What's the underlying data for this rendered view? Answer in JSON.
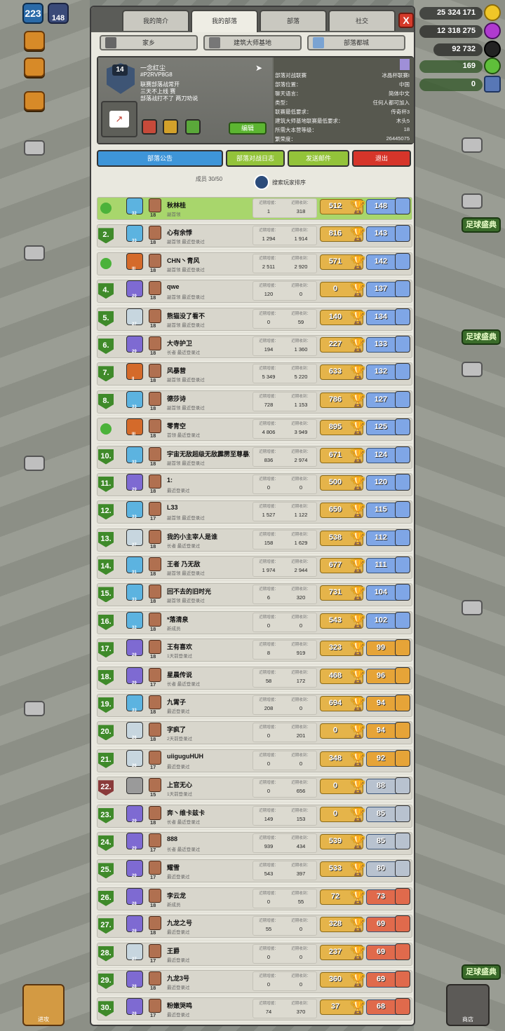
{
  "hud": {
    "level": "223",
    "troops_count": "148",
    "resources": [
      "25 324 171",
      "12 318 275",
      "92 732",
      "169",
      "0"
    ],
    "banner_labels": [
      "足球盛典",
      "足球盛典",
      "足球盛典"
    ]
  },
  "tabs": [
    {
      "label": "我的简介"
    },
    {
      "label": "我的部落"
    },
    {
      "label": "部落"
    },
    {
      "label": "社交"
    }
  ],
  "close_label": "X",
  "subtabs": [
    {
      "label": "家乡"
    },
    {
      "label": "建筑大师基地"
    },
    {
      "label": "部落都城"
    }
  ],
  "clan": {
    "level": "14",
    "name": "一念红尘",
    "tag": "#P2RVP8G8",
    "description_lines": [
      "联赛部落战常开",
      "三天不上线 赛",
      "部落战打不了 两刀劝说"
    ],
    "info_rows": [
      {
        "k": "部落对战联赛",
        "v": "冰晶杯联赛I"
      },
      {
        "k": "部落位置：",
        "v": "中国"
      },
      {
        "k": "聊天语言：",
        "v": "简体中文"
      },
      {
        "k": "类型：",
        "v": "任何人都可加入"
      },
      {
        "k": "联赛最低要求：",
        "v": "传奇杯3"
      },
      {
        "k": "建筑大师基地联赛最低要求：",
        "v": "木头5"
      },
      {
        "k": "所需大本营等级：",
        "v": "18"
      },
      {
        "k": "繁荣度：",
        "v": "26445075"
      }
    ],
    "edit_label": "编辑"
  },
  "actions": [
    {
      "label": "部落公告"
    },
    {
      "label": "部落对战日志"
    },
    {
      "label": "发送邮件"
    },
    {
      "label": "退出"
    }
  ],
  "members_label": "成员 30/50",
  "members_search_label": "搜索玩家排序",
  "stat_labels": {
    "donated": "近期增援：",
    "received": "近期收到："
  },
  "rows": [
    {
      "rank": "",
      "league": "32",
      "th": "18",
      "name": "秋林桂",
      "role": "副首领",
      "d": "1",
      "r": "318",
      "trophy": "512",
      "pvp": "148",
      "hl": "leader"
    },
    {
      "rank": "2.",
      "league": "33",
      "th": "18",
      "name": "心有余悸",
      "role": "副首领 最近登录过",
      "d": "1 294",
      "r": "1 914",
      "trophy": "816",
      "pvp": "143"
    },
    {
      "rank": "",
      "league": "III",
      "th": "18",
      "name": "CHN丶青风",
      "role": "副首领 最近登录过",
      "d": "2 511",
      "r": "2 920",
      "trophy": "571",
      "pvp": "142"
    },
    {
      "rank": "4.",
      "league": "29",
      "th": "18",
      "name": "qwe",
      "role": "副首领 最近登录过",
      "d": "120",
      "r": "0",
      "trophy": "0",
      "pvp": "137"
    },
    {
      "rank": "5.",
      "league": "27",
      "th": "18",
      "name": "熊猫没了看不",
      "role": "副首领 最近登录过",
      "d": "0",
      "r": "59",
      "trophy": "140",
      "pvp": "134"
    },
    {
      "rank": "6.",
      "league": "29",
      "th": "18",
      "name": "大寺护卫",
      "role": "长者 最近登录过",
      "d": "194",
      "r": "1 360",
      "trophy": "227",
      "pvp": "133"
    },
    {
      "rank": "7.",
      "league": "II",
      "th": "18",
      "name": "风暴营",
      "role": "副首领 最近登录过",
      "d": "5 349",
      "r": "5 220",
      "trophy": "633",
      "pvp": "132"
    },
    {
      "rank": "8.",
      "league": "33",
      "th": "18",
      "name": "德莎诗",
      "role": "副首领 最近登录过",
      "d": "728",
      "r": "1 153",
      "trophy": "786",
      "pvp": "127"
    },
    {
      "rank": "",
      "league": "III",
      "th": "18",
      "name": "零青空",
      "role": "首领 最近登录过",
      "d": "4 806",
      "r": "3 949",
      "trophy": "895",
      "pvp": "125"
    },
    {
      "rank": "10.",
      "league": "32",
      "th": "18",
      "name": "宇宙无敌超级无敌霹雳至尊暴龙战士",
      "role": "副首领 最近登录过",
      "d": "836",
      "r": "2 974",
      "trophy": "671",
      "pvp": "124"
    },
    {
      "rank": "11.",
      "league": "29",
      "th": "18",
      "name": "1:",
      "role": "最近登录过",
      "d": "0",
      "r": "0",
      "trophy": "500",
      "pvp": "120"
    },
    {
      "rank": "12.",
      "league": "33",
      "th": "17",
      "name": "L33",
      "role": "副首领 最近登录过",
      "d": "1 527",
      "r": "1 122",
      "trophy": "659",
      "pvp": "115"
    },
    {
      "rank": "13.",
      "league": "27",
      "th": "18",
      "name": "我的小主宰人是谁",
      "role": "长者 最近登录过",
      "d": "158",
      "r": "1 629",
      "trophy": "538",
      "pvp": "112"
    },
    {
      "rank": "14.",
      "league": "31",
      "th": "18",
      "name": "王者 乃无敌",
      "role": "副首领 最近登录过",
      "d": "1 974",
      "r": "2 944",
      "trophy": "677",
      "pvp": "111"
    },
    {
      "rank": "15.",
      "league": "33",
      "th": "18",
      "name": "回不去的旧时光",
      "role": "副首领 最近登录过",
      "d": "6",
      "r": "320",
      "trophy": "731",
      "pvp": "104"
    },
    {
      "rank": "16.",
      "league": "32",
      "th": "18",
      "name": "*落清泉",
      "role": "新成员",
      "d": "0",
      "r": "0",
      "trophy": "543",
      "pvp": "102"
    },
    {
      "rank": "17.",
      "league": "28",
      "th": "18",
      "name": "王有喜欢",
      "role": "1天前登录过",
      "d": "8",
      "r": "919",
      "trophy": "323",
      "pvp": "99"
    },
    {
      "rank": "18.",
      "league": "29",
      "th": "17",
      "name": "星晨传说",
      "role": "长者 最近登录过",
      "d": "58",
      "r": "172",
      "trophy": "468",
      "pvp": "96"
    },
    {
      "rank": "19.",
      "league": "33",
      "th": "18",
      "name": "九霄子",
      "role": "最近登录过",
      "d": "208",
      "r": "0",
      "trophy": "694",
      "pvp": "94"
    },
    {
      "rank": "20.",
      "league": "26",
      "th": "18",
      "name": "字疯了",
      "role": "2天前登录过",
      "d": "0",
      "r": "201",
      "trophy": "0",
      "pvp": "94"
    },
    {
      "rank": "21.",
      "league": "26",
      "th": "17",
      "name": "uiiguguHUH",
      "role": "最近登录过",
      "d": "0",
      "r": "0",
      "trophy": "348",
      "pvp": "92"
    },
    {
      "rank": "22.",
      "league": "",
      "th": "15",
      "name": "上官无心",
      "role": "1天前登录过",
      "d": "0",
      "r": "656",
      "trophy": "0",
      "pvp": "88",
      "rank_red": true
    },
    {
      "rank": "23.",
      "league": "29",
      "th": "18",
      "name": "奔丶维卡兹卡",
      "role": "长者 最近登录过",
      "d": "149",
      "r": "153",
      "trophy": "0",
      "pvp": "85"
    },
    {
      "rank": "24.",
      "league": "29",
      "th": "17",
      "name": "888",
      "role": "长者 最近登录过",
      "d": "939",
      "r": "434",
      "trophy": "539",
      "pvp": "85"
    },
    {
      "rank": "25.",
      "league": "29",
      "th": "17",
      "name": "耀雪",
      "role": "最近登录过",
      "d": "543",
      "r": "397",
      "trophy": "533",
      "pvp": "80"
    },
    {
      "rank": "26.",
      "league": "28",
      "th": "18",
      "name": "李云龙",
      "role": "新成员",
      "d": "0",
      "r": "55",
      "trophy": "72",
      "pvp": "73"
    },
    {
      "rank": "27.",
      "league": "28",
      "th": "18",
      "name": "九龙之号",
      "role": "最近登录过",
      "d": "55",
      "r": "0",
      "trophy": "328",
      "pvp": "69"
    },
    {
      "rank": "28.",
      "league": "27",
      "th": "17",
      "name": "王爵",
      "role": "最近登录过",
      "d": "0",
      "r": "0",
      "trophy": "237",
      "pvp": "69"
    },
    {
      "rank": "29.",
      "league": "28",
      "th": "18",
      "name": "九龙3号",
      "role": "最近登录过",
      "d": "0",
      "r": "0",
      "trophy": "360",
      "pvp": "69"
    },
    {
      "rank": "30.",
      "league": "28",
      "th": "17",
      "name": "粉嫩哭鸣",
      "role": "最近登录过",
      "d": "74",
      "r": "370",
      "trophy": "37",
      "pvp": "68"
    }
  ],
  "bottom": {
    "left_label": "进攻",
    "right_label": "商店"
  }
}
